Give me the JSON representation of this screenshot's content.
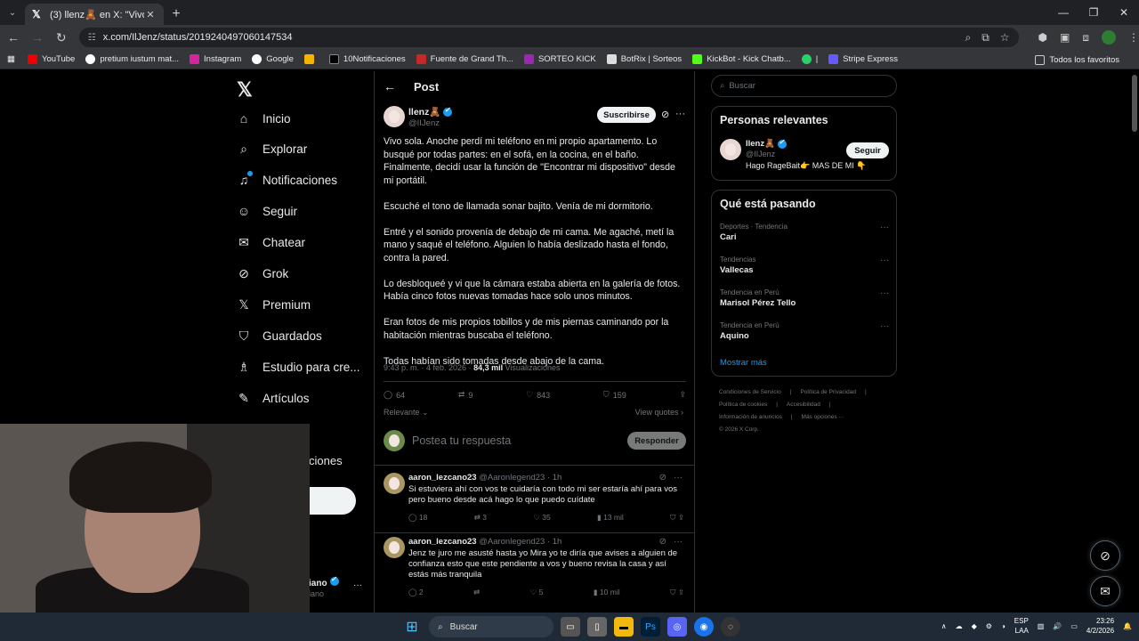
{
  "browser": {
    "tab_title": "(3) llenz🧸 en X: \"Vivo sola. An",
    "url": "x.com/IlJenz/status/2019240497060147534",
    "bookmarks": [
      "YouTube",
      "pretium iustum mat...",
      "Instagram",
      "Google",
      "",
      "10Notificaciones",
      "Fuente de Grand Th...",
      "SORTEO KICK",
      "BotRix | Sorteos",
      "KickBot - Kick Chatb...",
      "|",
      "Stripe Express"
    ],
    "bookmarks_right": "Todos los favoritos"
  },
  "nav": {
    "items": [
      "Inicio",
      "Explorar",
      "Notificaciones",
      "Seguir",
      "Chatear",
      "Grok",
      "Premium",
      "Guardados",
      "Estudio para cre...",
      "Artículos"
    ],
    "peek_item": "ciones",
    "peek_user": "iano",
    "peek_handle": "iano"
  },
  "post": {
    "header": "Post",
    "author_name": "llenz🧸",
    "author_handle": "@IIJenz",
    "subscribe_label": "Suscribirse",
    "paragraphs": [
      "Vivo sola. Anoche perdí mi teléfono en mi propio apartamento. Lo busqué por todas partes: en el sofá, en la cocina, en el baño. Finalmente, decidí usar la función de \"Encontrar mi dispositivo\" desde mi portátil.",
      "Escuché el tono de llamada sonar bajito. Venía de mi dormitorio.",
      "Entré y el sonido provenía de debajo de mi cama. Me agaché, metí la mano y saqué el teléfono. Alguien lo había deslizado hasta el fondo, contra la pared.",
      "Lo desbloqueé y vi que la cámara estaba abierta en la galería de fotos. Había cinco fotos nuevas tomadas hace solo unos minutos.",
      "Eran fotos de mis propios tobillos y de mis piernas caminando por la habitación mientras buscaba el teléfono.",
      "Todas habían sido tomadas desde abajo de la cama."
    ],
    "time": "9:43 p. m. · 4 feb. 2026 · ",
    "views_count": "84,3 mil",
    "views_label": " Visualizaciones",
    "replies": "64",
    "reposts": "9",
    "likes": "843",
    "bookmarks": "159",
    "relevant_label": "Relevante",
    "view_quotes": "View quotes",
    "reply_placeholder": "Postea tu respuesta",
    "reply_button": "Responder"
  },
  "replies": [
    {
      "name": "aaron_lezcano23",
      "meta": " @Aaronlegend23 · 1h",
      "text": "Si estuviera ahí con vos te cuidaría con todo mi ser estaría ahí para vos pero bueno desde acá hago lo que puedo cuídate",
      "replies": "18",
      "reposts": "3",
      "likes": "35",
      "views": "13 mil"
    },
    {
      "name": "aaron_lezcano23",
      "meta": " @Aaronlegend23 · 1h",
      "text": "Jenz te juro me asusté hasta yo Mira yo te diría que avises a alguien de confianza esto que este pendiente a vos y bueno revisa la casa y así estás más tranquila",
      "replies": "2",
      "reposts": "",
      "likes": "5",
      "views": "10 mil"
    }
  ],
  "sidebar": {
    "search_placeholder": "Buscar",
    "relevant_title": "Personas relevantes",
    "person_name": "llenz🧸",
    "person_handle": "@IIJenz",
    "person_bio": "Hago RageBait👉 MAS DE MI 👇",
    "follow_label": "Seguir",
    "trends_title": "Qué está pasando",
    "trends": [
      {
        "category": "Deportes · Tendencia",
        "title": "Cari"
      },
      {
        "category": "Tendencias",
        "title": "Vallecas"
      },
      {
        "category": "Tendencia en Perú",
        "title": "Marisol Pérez Tello"
      },
      {
        "category": "Tendencia en Perú",
        "title": "Aquino"
      }
    ],
    "show_more": "Mostrar más",
    "footer": [
      "Condiciones de Servicio",
      "|",
      "Política de Privacidad",
      "|",
      "Política de cookies",
      "|",
      "Accesibilidad",
      "|",
      "Información de anuncios",
      "|",
      "Más opciones ···",
      "© 2026 X Corp."
    ]
  },
  "taskbar": {
    "search": "Buscar",
    "lang1": "ESP",
    "lang2": "LAA",
    "time": "23:26",
    "date": "4/2/2026"
  }
}
